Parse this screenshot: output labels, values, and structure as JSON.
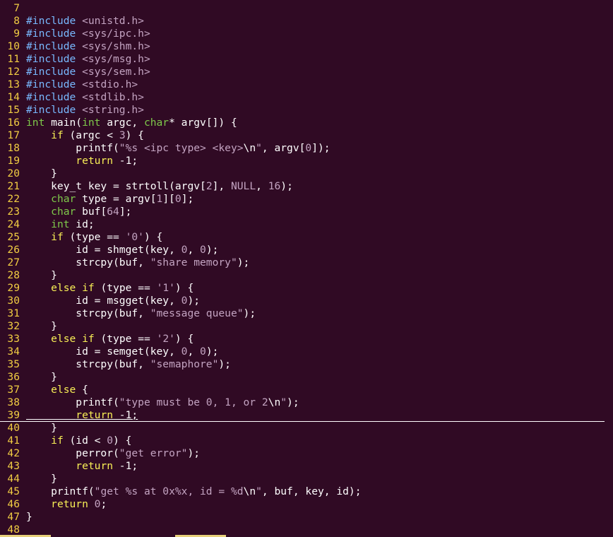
{
  "editor": {
    "cursor_line": 39,
    "lines": [
      {
        "n": "7",
        "tokens": []
      },
      {
        "n": "8",
        "tokens": [
          {
            "t": "#include",
            "c": "pp"
          },
          {
            "t": " ",
            "c": "plain"
          },
          {
            "t": "<unistd.h>",
            "c": "inc"
          }
        ]
      },
      {
        "n": "9",
        "tokens": [
          {
            "t": "#include",
            "c": "pp"
          },
          {
            "t": " ",
            "c": "plain"
          },
          {
            "t": "<sys/ipc.h>",
            "c": "inc"
          }
        ]
      },
      {
        "n": "10",
        "tokens": [
          {
            "t": "#include",
            "c": "pp"
          },
          {
            "t": " ",
            "c": "plain"
          },
          {
            "t": "<sys/shm.h>",
            "c": "inc"
          }
        ]
      },
      {
        "n": "11",
        "tokens": [
          {
            "t": "#include",
            "c": "pp"
          },
          {
            "t": " ",
            "c": "plain"
          },
          {
            "t": "<sys/msg.h>",
            "c": "inc"
          }
        ]
      },
      {
        "n": "12",
        "tokens": [
          {
            "t": "#include",
            "c": "pp"
          },
          {
            "t": " ",
            "c": "plain"
          },
          {
            "t": "<sys/sem.h>",
            "c": "inc"
          }
        ]
      },
      {
        "n": "13",
        "tokens": [
          {
            "t": "#include",
            "c": "pp"
          },
          {
            "t": " ",
            "c": "plain"
          },
          {
            "t": "<stdio.h>",
            "c": "inc"
          }
        ]
      },
      {
        "n": "14",
        "tokens": [
          {
            "t": "#include",
            "c": "pp"
          },
          {
            "t": " ",
            "c": "plain"
          },
          {
            "t": "<stdlib.h>",
            "c": "inc"
          }
        ]
      },
      {
        "n": "15",
        "tokens": [
          {
            "t": "#include",
            "c": "pp"
          },
          {
            "t": " ",
            "c": "plain"
          },
          {
            "t": "<string.h>",
            "c": "inc"
          }
        ]
      },
      {
        "n": "16",
        "tokens": [
          {
            "t": "int",
            "c": "ty"
          },
          {
            "t": " main(",
            "c": "plain"
          },
          {
            "t": "int",
            "c": "ty"
          },
          {
            "t": " argc, ",
            "c": "plain"
          },
          {
            "t": "char",
            "c": "ty"
          },
          {
            "t": "* argv[]) {",
            "c": "plain"
          }
        ]
      },
      {
        "n": "17",
        "tokens": [
          {
            "t": "    ",
            "c": "plain"
          },
          {
            "t": "if",
            "c": "kw"
          },
          {
            "t": " (argc < ",
            "c": "plain"
          },
          {
            "t": "3",
            "c": "num"
          },
          {
            "t": ") {",
            "c": "plain"
          }
        ]
      },
      {
        "n": "18",
        "tokens": [
          {
            "t": "        printf(",
            "c": "plain"
          },
          {
            "t": "\"%s <ipc type> <key>",
            "c": "str"
          },
          {
            "t": "\\n",
            "c": "plain"
          },
          {
            "t": "\"",
            "c": "str"
          },
          {
            "t": ", argv[",
            "c": "plain"
          },
          {
            "t": "0",
            "c": "num"
          },
          {
            "t": "]);",
            "c": "plain"
          }
        ]
      },
      {
        "n": "19",
        "tokens": [
          {
            "t": "        ",
            "c": "plain"
          },
          {
            "t": "return",
            "c": "kw"
          },
          {
            "t": " -1;",
            "c": "plain"
          }
        ]
      },
      {
        "n": "20",
        "tokens": [
          {
            "t": "    }",
            "c": "plain"
          }
        ]
      },
      {
        "n": "21",
        "tokens": [
          {
            "t": "    key_t key = strtoll(argv[",
            "c": "plain"
          },
          {
            "t": "2",
            "c": "num"
          },
          {
            "t": "], ",
            "c": "plain"
          },
          {
            "t": "NULL",
            "c": "num"
          },
          {
            "t": ", ",
            "c": "plain"
          },
          {
            "t": "16",
            "c": "num"
          },
          {
            "t": ");",
            "c": "plain"
          }
        ]
      },
      {
        "n": "22",
        "tokens": [
          {
            "t": "    ",
            "c": "plain"
          },
          {
            "t": "char",
            "c": "ty"
          },
          {
            "t": " type = argv[",
            "c": "plain"
          },
          {
            "t": "1",
            "c": "num"
          },
          {
            "t": "][",
            "c": "plain"
          },
          {
            "t": "0",
            "c": "num"
          },
          {
            "t": "];",
            "c": "plain"
          }
        ]
      },
      {
        "n": "23",
        "tokens": [
          {
            "t": "    ",
            "c": "plain"
          },
          {
            "t": "char",
            "c": "ty"
          },
          {
            "t": " buf[",
            "c": "plain"
          },
          {
            "t": "64",
            "c": "num"
          },
          {
            "t": "];",
            "c": "plain"
          }
        ]
      },
      {
        "n": "24",
        "tokens": [
          {
            "t": "    ",
            "c": "plain"
          },
          {
            "t": "int",
            "c": "ty"
          },
          {
            "t": " id;",
            "c": "plain"
          }
        ]
      },
      {
        "n": "25",
        "tokens": [
          {
            "t": "    ",
            "c": "plain"
          },
          {
            "t": "if",
            "c": "kw"
          },
          {
            "t": " (type == ",
            "c": "plain"
          },
          {
            "t": "'0'",
            "c": "str"
          },
          {
            "t": ") {",
            "c": "plain"
          }
        ]
      },
      {
        "n": "26",
        "tokens": [
          {
            "t": "        id = shmget(key, ",
            "c": "plain"
          },
          {
            "t": "0",
            "c": "num"
          },
          {
            "t": ", ",
            "c": "plain"
          },
          {
            "t": "0",
            "c": "num"
          },
          {
            "t": ");",
            "c": "plain"
          }
        ]
      },
      {
        "n": "27",
        "tokens": [
          {
            "t": "        strcpy(buf, ",
            "c": "plain"
          },
          {
            "t": "\"share memory\"",
            "c": "str"
          },
          {
            "t": ");",
            "c": "plain"
          }
        ]
      },
      {
        "n": "28",
        "tokens": [
          {
            "t": "    }",
            "c": "plain"
          }
        ]
      },
      {
        "n": "29",
        "tokens": [
          {
            "t": "    ",
            "c": "plain"
          },
          {
            "t": "else",
            "c": "kw"
          },
          {
            "t": " ",
            "c": "plain"
          },
          {
            "t": "if",
            "c": "kw"
          },
          {
            "t": " (type == ",
            "c": "plain"
          },
          {
            "t": "'1'",
            "c": "str"
          },
          {
            "t": ") {",
            "c": "plain"
          }
        ]
      },
      {
        "n": "30",
        "tokens": [
          {
            "t": "        id = msgget(key, ",
            "c": "plain"
          },
          {
            "t": "0",
            "c": "num"
          },
          {
            "t": ");",
            "c": "plain"
          }
        ]
      },
      {
        "n": "31",
        "tokens": [
          {
            "t": "        strcpy(buf, ",
            "c": "plain"
          },
          {
            "t": "\"message queue\"",
            "c": "str"
          },
          {
            "t": ");",
            "c": "plain"
          }
        ]
      },
      {
        "n": "32",
        "tokens": [
          {
            "t": "    }",
            "c": "plain"
          }
        ]
      },
      {
        "n": "33",
        "tokens": [
          {
            "t": "    ",
            "c": "plain"
          },
          {
            "t": "else",
            "c": "kw"
          },
          {
            "t": " ",
            "c": "plain"
          },
          {
            "t": "if",
            "c": "kw"
          },
          {
            "t": " (type == ",
            "c": "plain"
          },
          {
            "t": "'2'",
            "c": "str"
          },
          {
            "t": ") {",
            "c": "plain"
          }
        ]
      },
      {
        "n": "34",
        "tokens": [
          {
            "t": "        id = semget(key, ",
            "c": "plain"
          },
          {
            "t": "0",
            "c": "num"
          },
          {
            "t": ", ",
            "c": "plain"
          },
          {
            "t": "0",
            "c": "num"
          },
          {
            "t": ");",
            "c": "plain"
          }
        ]
      },
      {
        "n": "35",
        "tokens": [
          {
            "t": "        strcpy(buf, ",
            "c": "plain"
          },
          {
            "t": "\"semaphore\"",
            "c": "str"
          },
          {
            "t": ");",
            "c": "plain"
          }
        ]
      },
      {
        "n": "36",
        "tokens": [
          {
            "t": "    }",
            "c": "plain"
          }
        ]
      },
      {
        "n": "37",
        "tokens": [
          {
            "t": "    ",
            "c": "plain"
          },
          {
            "t": "else",
            "c": "kw"
          },
          {
            "t": " {",
            "c": "plain"
          }
        ]
      },
      {
        "n": "38",
        "tokens": [
          {
            "t": "        printf(",
            "c": "plain"
          },
          {
            "t": "\"type must be 0, 1, or 2",
            "c": "str"
          },
          {
            "t": "\\n",
            "c": "plain"
          },
          {
            "t": "\"",
            "c": "str"
          },
          {
            "t": ");",
            "c": "plain"
          }
        ]
      },
      {
        "n": "39",
        "tokens": [
          {
            "t": "        ",
            "c": "plain"
          },
          {
            "t": "return",
            "c": "kw"
          },
          {
            "t": " -1;",
            "c": "plain"
          }
        ]
      },
      {
        "n": "40",
        "tokens": [
          {
            "t": "    }",
            "c": "plain"
          }
        ]
      },
      {
        "n": "41",
        "tokens": [
          {
            "t": "    ",
            "c": "plain"
          },
          {
            "t": "if",
            "c": "kw"
          },
          {
            "t": " (id < ",
            "c": "plain"
          },
          {
            "t": "0",
            "c": "num"
          },
          {
            "t": ") {",
            "c": "plain"
          }
        ]
      },
      {
        "n": "42",
        "tokens": [
          {
            "t": "        perror(",
            "c": "plain"
          },
          {
            "t": "\"get error\"",
            "c": "str"
          },
          {
            "t": ");",
            "c": "plain"
          }
        ]
      },
      {
        "n": "43",
        "tokens": [
          {
            "t": "        ",
            "c": "plain"
          },
          {
            "t": "return",
            "c": "kw"
          },
          {
            "t": " -1;",
            "c": "plain"
          }
        ]
      },
      {
        "n": "44",
        "tokens": [
          {
            "t": "    }",
            "c": "plain"
          }
        ]
      },
      {
        "n": "45",
        "tokens": [
          {
            "t": "    printf(",
            "c": "plain"
          },
          {
            "t": "\"get %s at 0x%x, id = %d",
            "c": "str"
          },
          {
            "t": "\\n",
            "c": "plain"
          },
          {
            "t": "\"",
            "c": "str"
          },
          {
            "t": ", buf, key, id);",
            "c": "plain"
          }
        ]
      },
      {
        "n": "46",
        "tokens": [
          {
            "t": "    ",
            "c": "plain"
          },
          {
            "t": "return",
            "c": "kw"
          },
          {
            "t": " ",
            "c": "plain"
          },
          {
            "t": "0",
            "c": "num"
          },
          {
            "t": ";",
            "c": "plain"
          }
        ]
      },
      {
        "n": "47",
        "tokens": [
          {
            "t": "}",
            "c": "plain"
          }
        ]
      },
      {
        "n": "48",
        "tokens": []
      }
    ]
  },
  "colors": {
    "background": "#300a24",
    "line_number": "#f2ce43",
    "preprocessor": "#78b9ff",
    "type": "#7ec94a",
    "keyword": "#f8ef56",
    "string": "#c3a3c1"
  }
}
